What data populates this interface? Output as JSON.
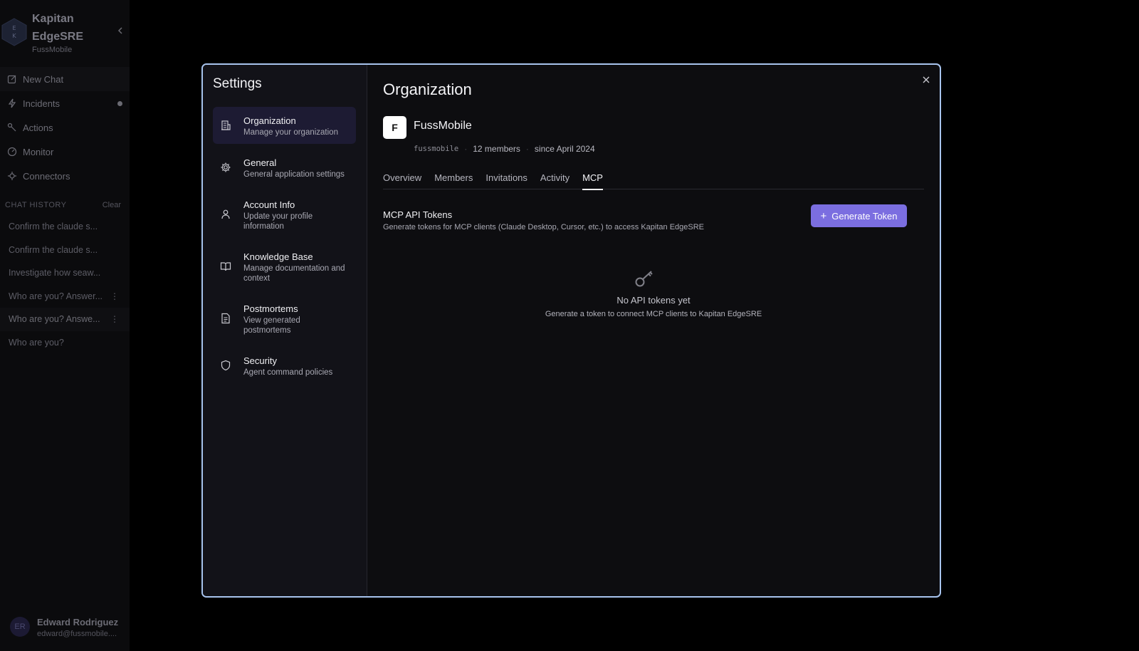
{
  "app": {
    "name": "Kapitan EdgeSRE",
    "org": "FussMobile",
    "logo_letters": "E K",
    "nav": [
      {
        "label": "New Chat",
        "icon": "edit-icon"
      },
      {
        "label": "Incidents",
        "icon": "bolt-icon"
      },
      {
        "label": "Actions",
        "icon": "actions-icon"
      },
      {
        "label": "Monitor",
        "icon": "gauge-icon"
      },
      {
        "label": "Connectors",
        "icon": "plug-icon"
      }
    ],
    "history_title": "CHAT HISTORY",
    "history_clear": "Clear",
    "history": [
      "Confirm the claude s...",
      "Confirm the claude s...",
      "Investigate how seaw...",
      "Who are you? Answer...",
      "Who are you? Answe...",
      "Who are you?"
    ],
    "user": {
      "initials": "ER",
      "name": "Edward Rodriguez",
      "email": "edward@fussmobile...."
    }
  },
  "settings": {
    "title": "Settings",
    "items": [
      {
        "label": "Organization",
        "sub": "Manage your organization",
        "icon": "building-icon"
      },
      {
        "label": "General",
        "sub": "General application settings",
        "icon": "gear-icon"
      },
      {
        "label": "Account Info",
        "sub": "Update your profile information",
        "icon": "user-icon"
      },
      {
        "label": "Knowledge Base",
        "sub": "Manage documentation and context",
        "icon": "book-icon"
      },
      {
        "label": "Postmortems",
        "sub": "View generated postmortems",
        "icon": "document-icon"
      },
      {
        "label": "Security",
        "sub": "Agent command policies",
        "icon": "shield-icon"
      }
    ]
  },
  "org_page": {
    "title": "Organization",
    "org_initial": "F",
    "org_name": "FussMobile",
    "org_slug": "fussmobile",
    "members": "12 members",
    "since": "since April 2024",
    "tabs": [
      "Overview",
      "Members",
      "Invitations",
      "Activity",
      "MCP"
    ],
    "active_tab": "MCP",
    "mcp": {
      "title": "MCP API Tokens",
      "description": "Generate tokens for MCP clients (Claude Desktop, Cursor, etc.) to access Kapitan EdgeSRE",
      "generate_label": "Generate Token",
      "empty_title": "No API tokens yet",
      "empty_sub": "Generate a token to connect MCP clients to Kapitan EdgeSRE"
    }
  },
  "colors": {
    "accent": "#7b6ee0",
    "modal_border": "#a8c4ee",
    "active_nav": "#1d1b33"
  }
}
